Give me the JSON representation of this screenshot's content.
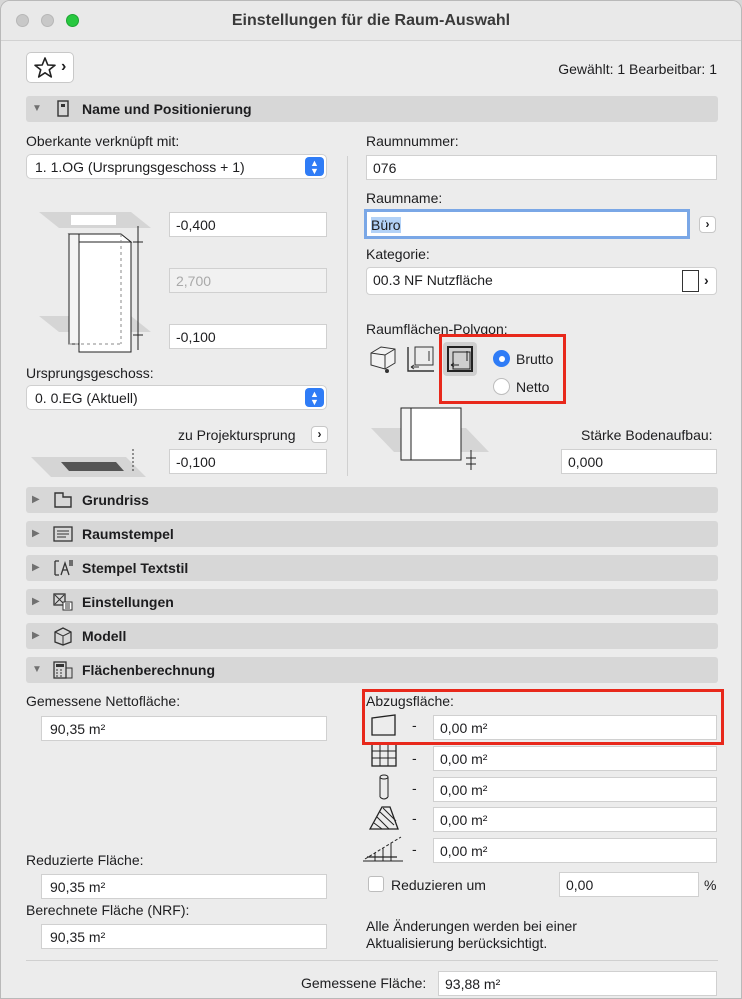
{
  "window": {
    "title": "Einstellungen für die Raum-Auswahl"
  },
  "header": {
    "selection_info": "Gewählt: 1 Bearbeitbar: 1",
    "favorites_arrow": "›"
  },
  "sections": {
    "name": "Name und Positionierung",
    "grundriss": "Grundriss",
    "raumstempel": "Raumstempel",
    "textstil": "Stempel Textstil",
    "einstellungen": "Einstellungen",
    "modell": "Modell",
    "flaechen": "Flächenberechnung"
  },
  "positioning": {
    "oberkante_label": "Oberkante verknüpft mit:",
    "oberkante_value": "1. 1.OG (Ursprungsgeschoss + 1)",
    "top_offset": "-0,400",
    "height": "2,700",
    "bottom_offset": "-0,100",
    "ursprung_label": "Ursprungsgeschoss:",
    "ursprung_value": "0. 0.EG (Aktuell)",
    "projekt_label": "zu Projektursprung",
    "projekt_value": "-0,100"
  },
  "room": {
    "nummer_label": "Raumnummer:",
    "nummer_value": "076",
    "name_label": "Raumname:",
    "name_value": "Büro",
    "kategorie_label": "Kategorie:",
    "kategorie_value": "00.3 NF Nutzfläche",
    "polygon_label": "Raumflächen-Polygon:",
    "brutto": "Brutto",
    "netto": "Netto",
    "boden_label": "Stärke Bodenaufbau:",
    "boden_value": "0,000"
  },
  "area": {
    "netto_label": "Gemessene Nettofläche:",
    "netto_value": "90,35 m²",
    "abzug_label": "Abzugsfläche:",
    "abzug_rows": [
      {
        "dash": "-",
        "value": "0,00 m²"
      },
      {
        "dash": "-",
        "value": "0,00 m²"
      },
      {
        "dash": "-",
        "value": "0,00 m²"
      },
      {
        "dash": "-",
        "value": "0,00 m²"
      },
      {
        "dash": "-",
        "value": "0,00 m²"
      }
    ],
    "reduziert_label": "Reduzierte Fläche:",
    "reduziert_value": "90,35 m²",
    "reduzieren_label": "Reduzieren um",
    "reduzieren_value": "0,00",
    "percent": "%",
    "nrf_label": "Berechnete Fläche (NRF):",
    "nrf_value": "90,35 m²",
    "note": "Alle Änderungen werden bei einer Aktualisierung berücksichtigt.",
    "gemessen_label": "Gemessene Fläche:",
    "gemessen_value": "93,88 m²"
  },
  "colors": {
    "accent": "#2f7cf6",
    "highlight": "#e8281b",
    "section_bg": "#d7d7d7"
  }
}
